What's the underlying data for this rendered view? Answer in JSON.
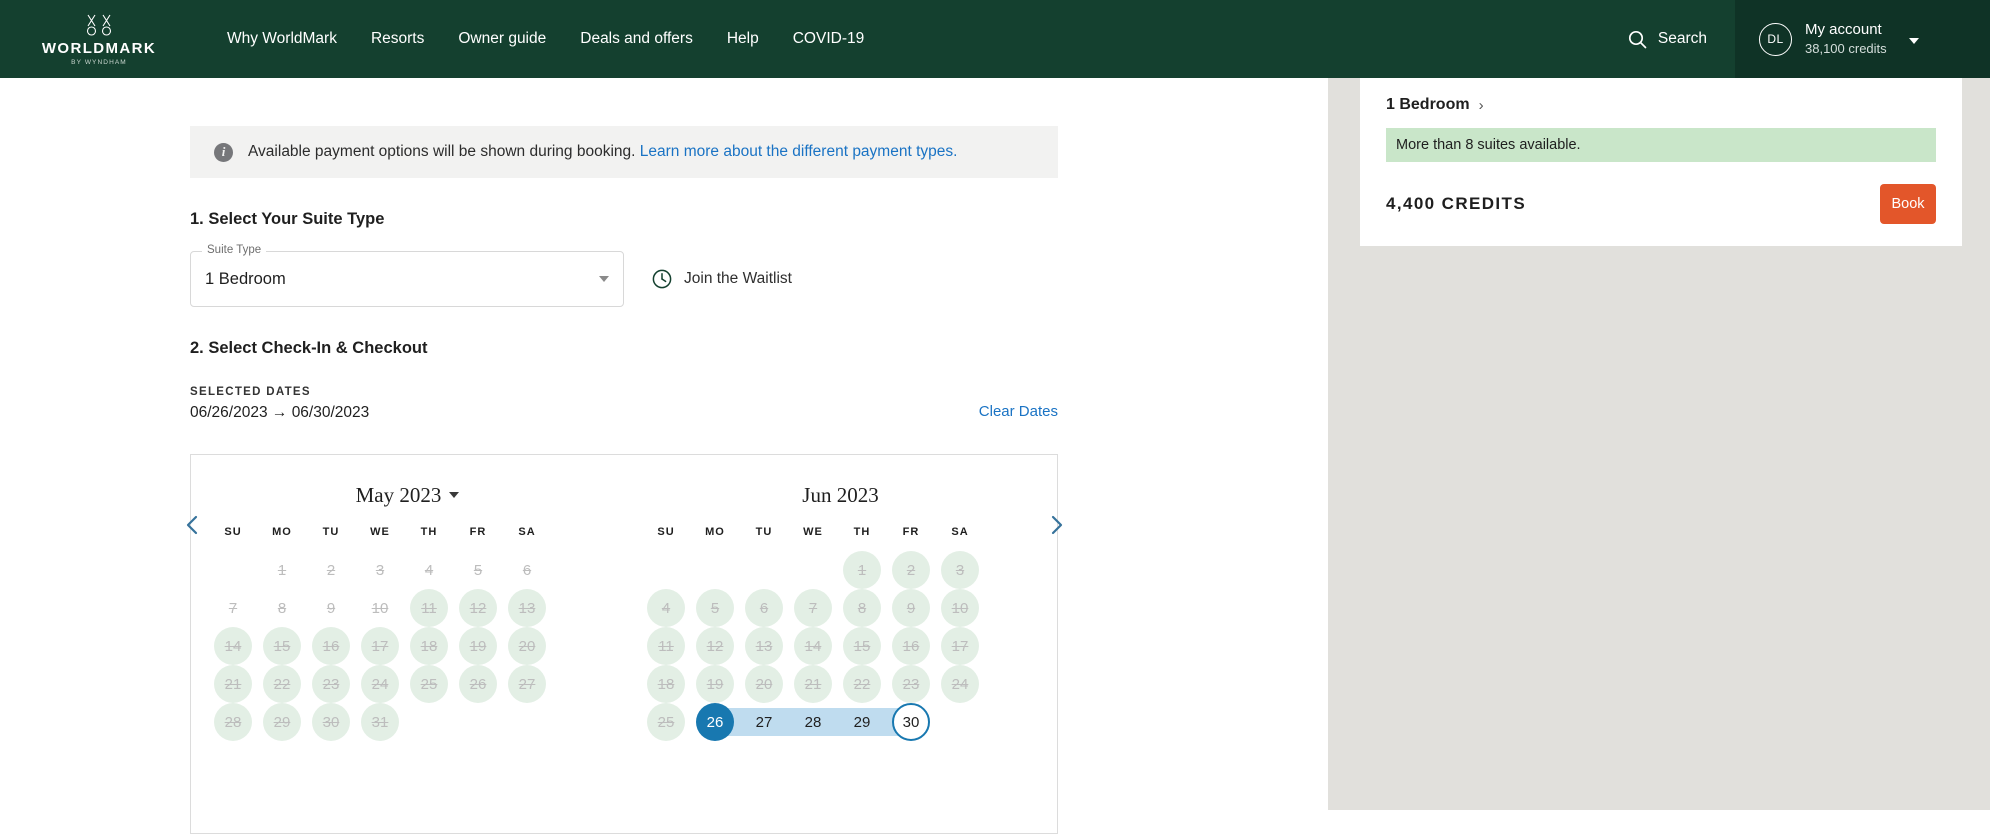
{
  "header": {
    "logo_word": "WORLDMARK",
    "logo_sub": "BY WYNDHAM",
    "nav": [
      {
        "label": "Why WorldMark"
      },
      {
        "label": "Resorts"
      },
      {
        "label": "Owner guide"
      },
      {
        "label": "Deals and offers"
      },
      {
        "label": "Help"
      },
      {
        "label": "COVID-19"
      }
    ],
    "search_label": "Search",
    "account": {
      "initials": "DL",
      "name": "My account",
      "credits": "38,100 credits"
    }
  },
  "banner": {
    "text": "Available payment options will be shown during booking. ",
    "link": "Learn more about the different payment types."
  },
  "step1": {
    "title": "1. Select Your Suite Type",
    "select_legend": "Suite Type",
    "select_value": "1 Bedroom",
    "waitlist_label": "Join the Waitlist"
  },
  "step2": {
    "title": "2. Select Check-In & Checkout",
    "selected_label": "SELECTED DATES",
    "selected_value": "06/26/2023 → 06/30/2023",
    "clear_label": "Clear Dates"
  },
  "calendar": {
    "dow": [
      "SU",
      "MO",
      "TU",
      "WE",
      "TH",
      "FR",
      "SA"
    ],
    "months": [
      {
        "title": "May 2023",
        "has_caret": true,
        "has_prev": true,
        "has_next": false,
        "weeks": [
          [
            {
              "n": "",
              "s": "empty"
            },
            {
              "n": "1",
              "s": "plain"
            },
            {
              "n": "2",
              "s": "plain"
            },
            {
              "n": "3",
              "s": "plain"
            },
            {
              "n": "4",
              "s": "plain"
            },
            {
              "n": "5",
              "s": "plain"
            },
            {
              "n": "6",
              "s": "plain"
            }
          ],
          [
            {
              "n": "7",
              "s": "plain"
            },
            {
              "n": "8",
              "s": "plain"
            },
            {
              "n": "9",
              "s": "plain"
            },
            {
              "n": "10",
              "s": "plain"
            },
            {
              "n": "11",
              "s": "avail"
            },
            {
              "n": "12",
              "s": "avail"
            },
            {
              "n": "13",
              "s": "avail"
            }
          ],
          [
            {
              "n": "14",
              "s": "avail"
            },
            {
              "n": "15",
              "s": "avail"
            },
            {
              "n": "16",
              "s": "avail"
            },
            {
              "n": "17",
              "s": "avail"
            },
            {
              "n": "18",
              "s": "avail"
            },
            {
              "n": "19",
              "s": "avail"
            },
            {
              "n": "20",
              "s": "avail"
            }
          ],
          [
            {
              "n": "21",
              "s": "avail"
            },
            {
              "n": "22",
              "s": "avail"
            },
            {
              "n": "23",
              "s": "avail"
            },
            {
              "n": "24",
              "s": "avail"
            },
            {
              "n": "25",
              "s": "avail"
            },
            {
              "n": "26",
              "s": "avail"
            },
            {
              "n": "27",
              "s": "avail"
            }
          ],
          [
            {
              "n": "28",
              "s": "avail"
            },
            {
              "n": "29",
              "s": "avail"
            },
            {
              "n": "30",
              "s": "avail"
            },
            {
              "n": "31",
              "s": "avail"
            },
            {
              "n": "",
              "s": "empty"
            },
            {
              "n": "",
              "s": "empty"
            },
            {
              "n": "",
              "s": "empty"
            }
          ]
        ]
      },
      {
        "title": "Jun 2023",
        "has_caret": false,
        "has_prev": false,
        "has_next": true,
        "weeks": [
          [
            {
              "n": "",
              "s": "empty"
            },
            {
              "n": "",
              "s": "empty"
            },
            {
              "n": "",
              "s": "empty"
            },
            {
              "n": "",
              "s": "empty"
            },
            {
              "n": "1",
              "s": "avail"
            },
            {
              "n": "2",
              "s": "avail"
            },
            {
              "n": "3",
              "s": "avail"
            }
          ],
          [
            {
              "n": "4",
              "s": "avail"
            },
            {
              "n": "5",
              "s": "avail"
            },
            {
              "n": "6",
              "s": "avail"
            },
            {
              "n": "7",
              "s": "avail"
            },
            {
              "n": "8",
              "s": "avail"
            },
            {
              "n": "9",
              "s": "avail"
            },
            {
              "n": "10",
              "s": "avail"
            }
          ],
          [
            {
              "n": "11",
              "s": "avail"
            },
            {
              "n": "12",
              "s": "avail"
            },
            {
              "n": "13",
              "s": "avail"
            },
            {
              "n": "14",
              "s": "avail"
            },
            {
              "n": "15",
              "s": "avail"
            },
            {
              "n": "16",
              "s": "avail"
            },
            {
              "n": "17",
              "s": "avail"
            }
          ],
          [
            {
              "n": "18",
              "s": "avail"
            },
            {
              "n": "19",
              "s": "avail"
            },
            {
              "n": "20",
              "s": "avail"
            },
            {
              "n": "21",
              "s": "avail"
            },
            {
              "n": "22",
              "s": "avail"
            },
            {
              "n": "23",
              "s": "avail"
            },
            {
              "n": "24",
              "s": "avail"
            }
          ],
          [
            {
              "n": "25",
              "s": "avail"
            },
            {
              "n": "26",
              "s": "sel-start"
            },
            {
              "n": "27",
              "s": "sel-mid"
            },
            {
              "n": "28",
              "s": "sel-mid"
            },
            {
              "n": "29",
              "s": "sel-mid"
            },
            {
              "n": "30",
              "s": "sel-end"
            },
            {
              "n": "",
              "s": "empty"
            }
          ]
        ]
      }
    ]
  },
  "sidebar": {
    "suite_title": "1 Bedroom",
    "availability": "More than 8 suites available.",
    "credits": "4,400 CREDITS",
    "book_label": "Book"
  },
  "colors": {
    "header_green": "#14402F",
    "account_green": "#0F3326",
    "link_blue": "#1A73C4",
    "select_blue": "#1878B0",
    "band_blue": "#BFDCEF",
    "avail_green": "#E3EFE5",
    "badge_green": "#C9E6C9",
    "book_orange": "#E3562A",
    "page_gray": "#E1E0DC"
  }
}
